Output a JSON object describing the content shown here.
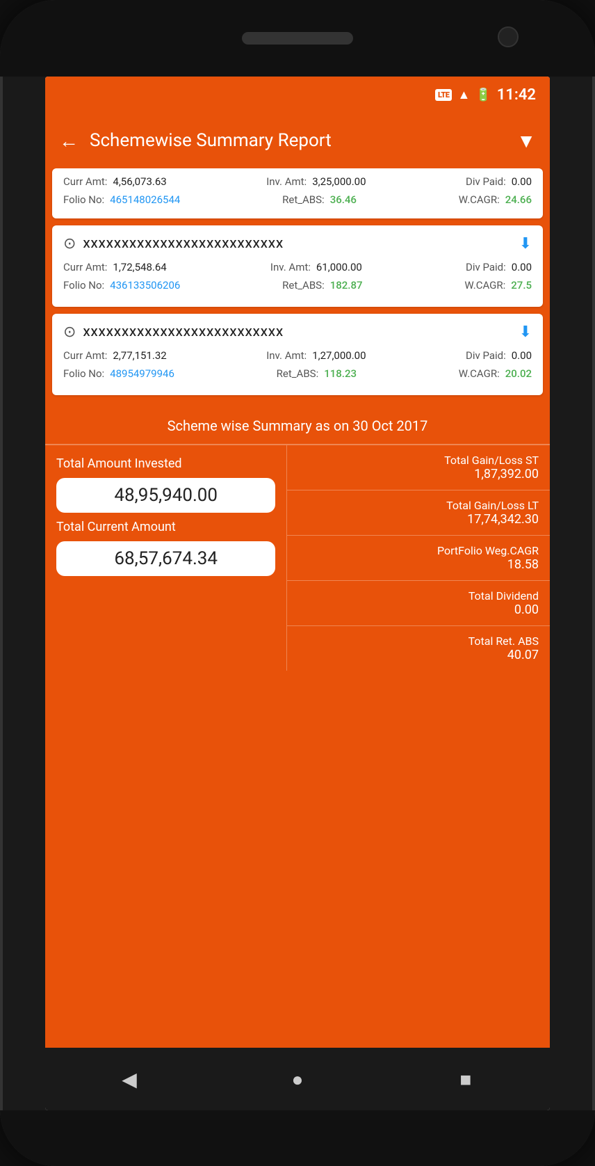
{
  "status_bar": {
    "lte": "LTE",
    "time": "11:42"
  },
  "header": {
    "back_label": "←",
    "title": "Schemewise Summary Report",
    "filter_icon": "filter"
  },
  "partial_card": {
    "curr_amt_label": "Curr Amt:",
    "curr_amt_value": "4,56,073.63",
    "inv_amt_label": "Inv. Amt:",
    "inv_amt_value": "3,25,000.00",
    "div_paid_label": "Div Paid:",
    "div_paid_value": "0.00",
    "folio_label": "Folio No:",
    "folio_value": "465148026544",
    "ret_abs_label": "Ret_ABS:",
    "ret_abs_value": "36.46",
    "wcagr_label": "W.CAGR:",
    "wcagr_value": "24.66"
  },
  "card1": {
    "masked_name": "XXXXXXXXXXXXXXXXXXXXXXXXXX",
    "curr_amt_label": "Curr Amt:",
    "curr_amt_value": "1,72,548.64",
    "inv_amt_label": "Inv. Amt:",
    "inv_amt_value": "61,000.00",
    "div_paid_label": "Div Paid:",
    "div_paid_value": "0.00",
    "folio_label": "Folio No:",
    "folio_value": "436133506206",
    "ret_abs_label": "Ret_ABS:",
    "ret_abs_value": "182.87",
    "wcagr_label": "W.CAGR:",
    "wcagr_value": "27.5"
  },
  "card2": {
    "masked_name": "XXXXXXXXXXXXXXXXXXXXXXXXXX",
    "curr_amt_label": "Curr Amt:",
    "curr_amt_value": "2,77,151.32",
    "inv_amt_label": "Inv. Amt:",
    "inv_amt_value": "1,27,000.00",
    "div_paid_label": "Div Paid:",
    "div_paid_value": "0.00",
    "folio_label": "Folio No:",
    "folio_value": "48954979946",
    "ret_abs_label": "Ret_ABS:",
    "ret_abs_value": "118.23",
    "wcagr_label": "W.CAGR:",
    "wcagr_value": "20.02"
  },
  "summary": {
    "title": "Scheme wise Summary as on 30 Oct 2017",
    "total_amount_invested_label": "Total Amount Invested",
    "total_amount_invested_value": "48,95,940.00",
    "total_current_amount_label": "Total Current Amount",
    "total_current_amount_value": "68,57,674.34",
    "total_gain_loss_st_label": "Total Gain/Loss ST",
    "total_gain_loss_st_value": "1,87,392.00",
    "total_gain_loss_lt_label": "Total Gain/Loss LT",
    "total_gain_loss_lt_value": "17,74,342.30",
    "portfolio_wcagr_label": "PortFolio Weg.CAGR",
    "portfolio_wcagr_value": "18.58",
    "total_dividend_label": "Total Dividend",
    "total_dividend_value": "0.00",
    "total_ret_abs_label": "Total Ret. ABS",
    "total_ret_abs_value": "40.07"
  },
  "nav": {
    "back": "◀",
    "home": "●",
    "square": "■"
  }
}
